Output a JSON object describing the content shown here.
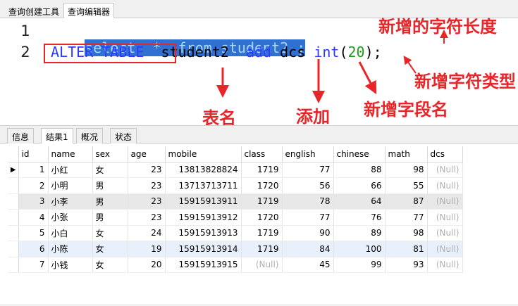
{
  "top_tabs": [
    {
      "label": "查询创建工具",
      "active": false
    },
    {
      "label": "查询编辑器",
      "active": true
    }
  ],
  "editor": {
    "line_numbers": [
      "1",
      "2"
    ],
    "line1": "select  *  from student2 ;",
    "line2": {
      "kw1": "ALTER TABLE",
      "table": "student2",
      "kw2": "add",
      "column": "dcs",
      "type": "int",
      "paren_open": "(",
      "length": "20",
      "paren_close": ");"
    }
  },
  "annotations": {
    "length_label": "新增的字符长度",
    "type_label": "新增字符类型",
    "table_label": "表名",
    "add_label": "添加",
    "field_label": "新增字段名"
  },
  "bottom_tabs": [
    {
      "label": "信息",
      "active": false
    },
    {
      "label": "结果1",
      "active": true
    },
    {
      "label": "概况",
      "active": false
    },
    {
      "label": "状态",
      "active": false
    }
  ],
  "grid": {
    "columns": [
      "id",
      "name",
      "sex",
      "age",
      "mobile",
      "class",
      "english",
      "chinese",
      "math",
      "dcs"
    ],
    "rows": [
      [
        "1",
        "小红",
        "女",
        "23",
        "13813828824",
        "1719",
        "77",
        "88",
        "98",
        "(Null)"
      ],
      [
        "2",
        "小明",
        "男",
        "23",
        "13713713711",
        "1720",
        "56",
        "66",
        "55",
        "(Null)"
      ],
      [
        "3",
        "小李",
        "男",
        "23",
        "15915913911",
        "1719",
        "78",
        "64",
        "87",
        "(Null)"
      ],
      [
        "4",
        "小张",
        "男",
        "23",
        "15915913912",
        "1720",
        "77",
        "76",
        "77",
        "(Null)"
      ],
      [
        "5",
        "小白",
        "女",
        "24",
        "15915913913",
        "1719",
        "90",
        "89",
        "98",
        "(Null)"
      ],
      [
        "6",
        "小陈",
        "女",
        "19",
        "15915913914",
        "1719",
        "84",
        "100",
        "81",
        "(Null)"
      ],
      [
        "7",
        "小钱",
        "女",
        "20",
        "15915913915",
        "(Null)",
        "45",
        "99",
        "93",
        "(Null)"
      ]
    ],
    "current_row_marker": "▶",
    "highlighted_rows": [
      3,
      6
    ]
  },
  "colors": {
    "annotation_red": "#e8262a",
    "selection_blue": "#2f70d0",
    "keyword_blue": "#2a3aff",
    "number_green": "#1b9e1b"
  }
}
